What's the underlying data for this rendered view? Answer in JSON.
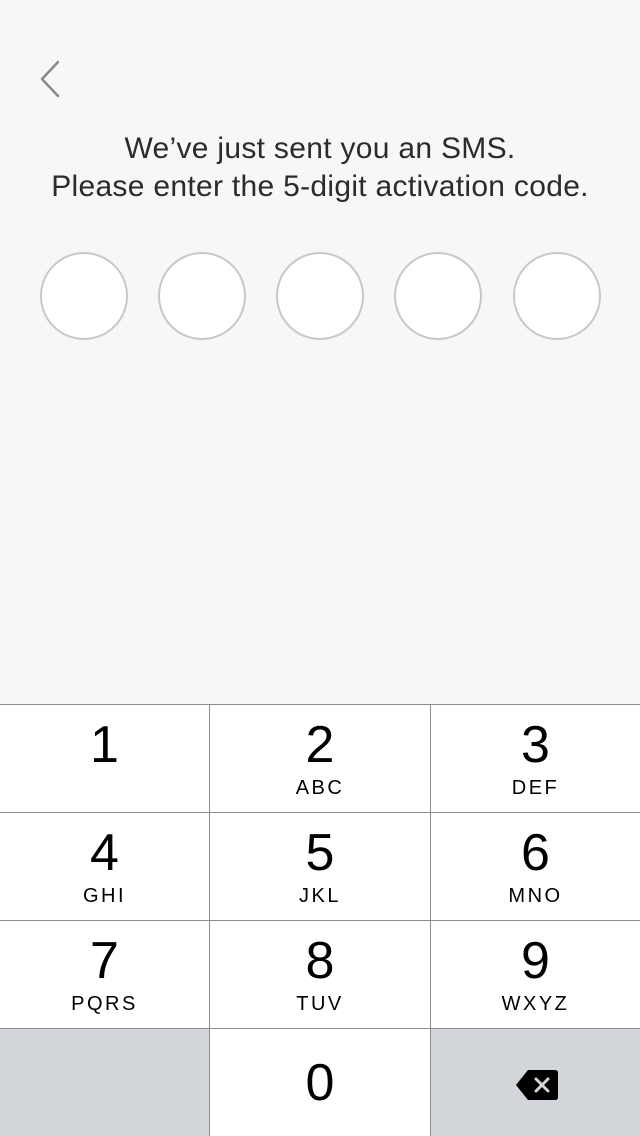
{
  "nav": {
    "back_icon": "chevron-left-icon"
  },
  "instructions": {
    "line1": "We’ve just sent you an SMS.",
    "line2": "Please enter the 5-digit activation code."
  },
  "code": {
    "length": 5,
    "digits": [
      "",
      "",
      "",
      "",
      ""
    ]
  },
  "keypad": {
    "keys": [
      {
        "digit": "1",
        "letters": ""
      },
      {
        "digit": "2",
        "letters": "ABC"
      },
      {
        "digit": "3",
        "letters": "DEF"
      },
      {
        "digit": "4",
        "letters": "GHI"
      },
      {
        "digit": "5",
        "letters": "JKL"
      },
      {
        "digit": "6",
        "letters": "MNO"
      },
      {
        "digit": "7",
        "letters": "PQRS"
      },
      {
        "digit": "8",
        "letters": "TUV"
      },
      {
        "digit": "9",
        "letters": "WXYZ"
      }
    ],
    "zero": {
      "digit": "0"
    },
    "delete_icon": "backspace-icon"
  },
  "colors": {
    "background": "#f7f7f7",
    "text": "#2b2b2b",
    "slot_border": "#c8c8c8",
    "key_background": "#ffffff",
    "key_separator": "#8c8c8c",
    "function_key_background": "#d2d5da"
  }
}
